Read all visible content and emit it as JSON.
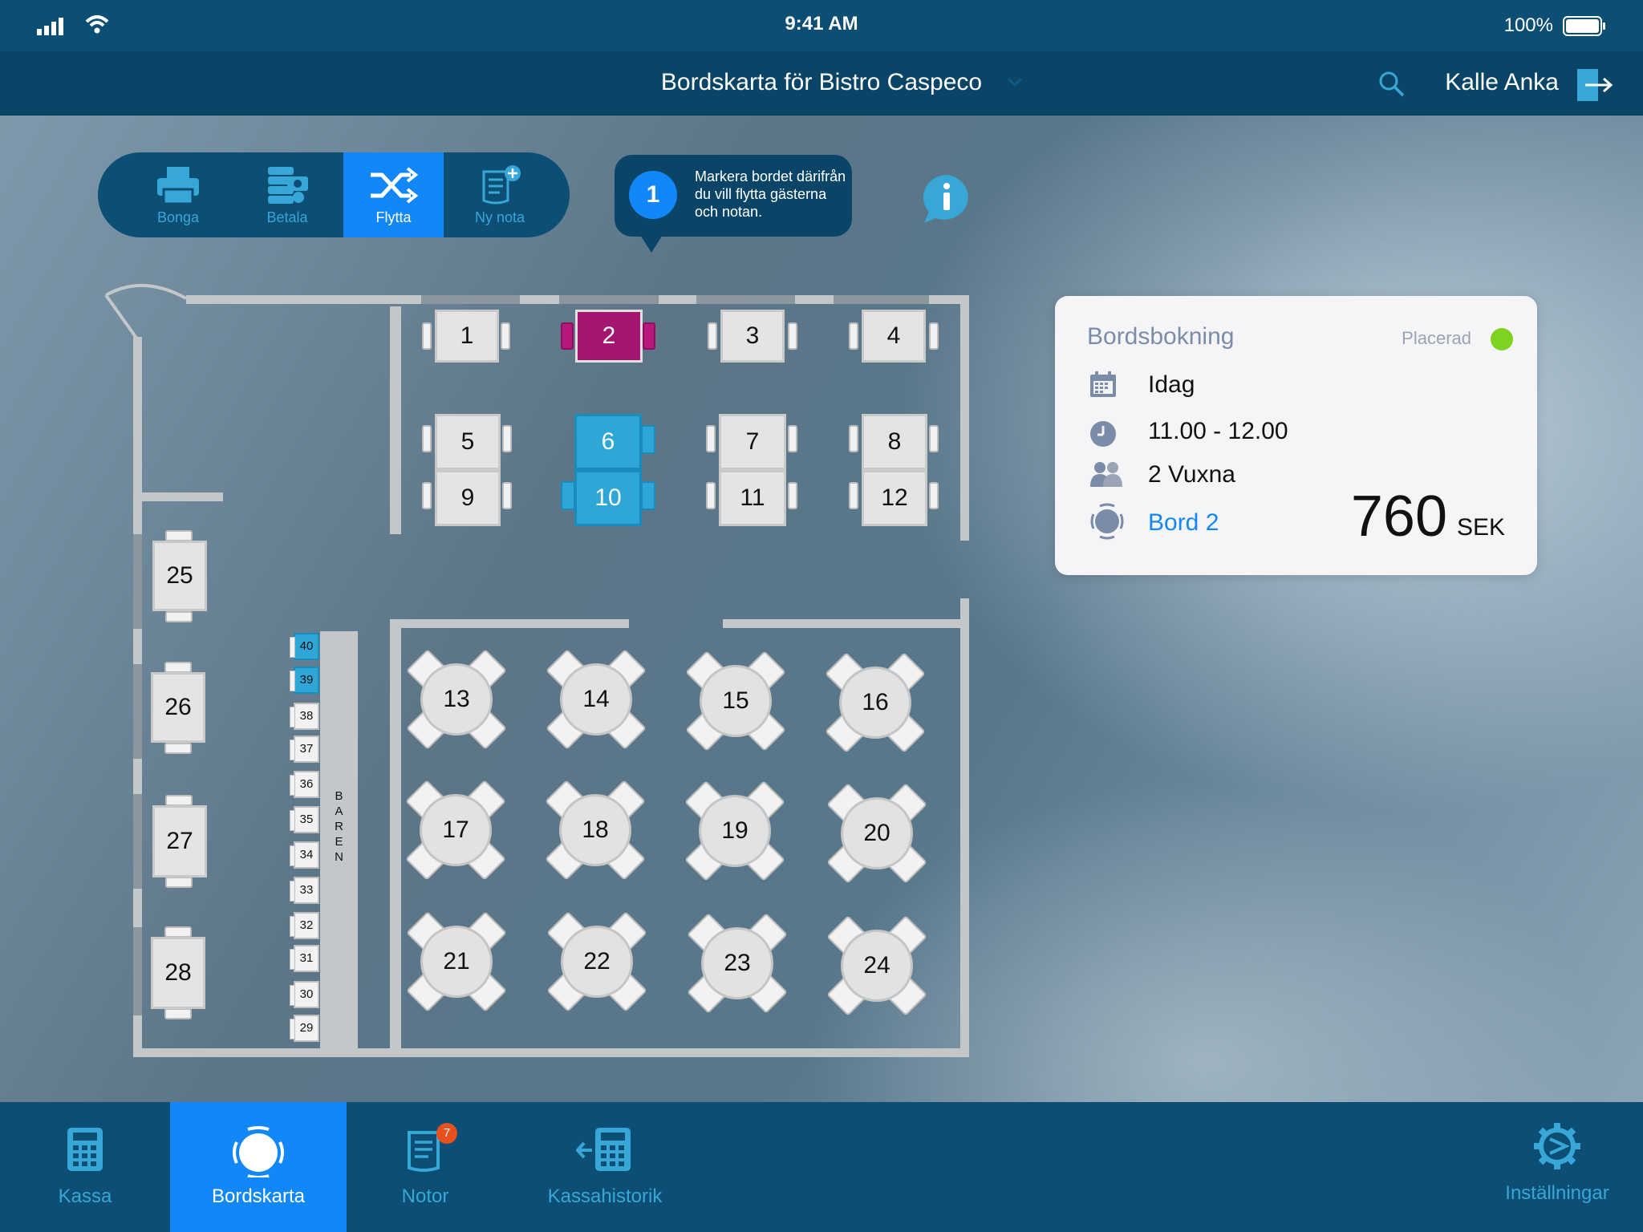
{
  "status_bar": {
    "time": "9:41 AM",
    "battery": "100%"
  },
  "nav": {
    "title": "Bordskarta för Bistro Caspeco",
    "user": "Kalle Anka"
  },
  "toolbar": {
    "bonga": "Bonga",
    "betala": "Betala",
    "flytta": "Flytta",
    "ny_nota": "Ny nota"
  },
  "tooltip": {
    "step": "1",
    "text": "Markera bordet därifrån du vill flytta gästerna och notan."
  },
  "tables": {
    "t1": "1",
    "t2": "2",
    "t3": "3",
    "t4": "4",
    "t5": "5",
    "t6": "6",
    "t7": "7",
    "t8": "8",
    "t9": "9",
    "t10": "10",
    "t11": "11",
    "t12": "12",
    "t13": "13",
    "t14": "14",
    "t15": "15",
    "t16": "16",
    "t17": "17",
    "t18": "18",
    "t19": "19",
    "t20": "20",
    "t21": "21",
    "t22": "22",
    "t23": "23",
    "t24": "24",
    "t25": "25",
    "t26": "26",
    "t27": "27",
    "t28": "28"
  },
  "bar_seats": [
    "40",
    "39",
    "38",
    "37",
    "36",
    "35",
    "34",
    "33",
    "32",
    "31",
    "30",
    "29"
  ],
  "bar_label": "B A R E N",
  "booking": {
    "header": "Bordsbokning",
    "status": "Placerad",
    "date": "Idag",
    "time": "11.00 - 12.00",
    "guests": "2 Vuxna",
    "table": "Bord 2",
    "amount": "760",
    "currency": "SEK"
  },
  "tabs": {
    "kassa": "Kassa",
    "bordskarta": "Bordskarta",
    "notor": "Notor",
    "notor_badge": "7",
    "kassahistorik": "Kassahistorik",
    "installningar": "Inställningar"
  },
  "colors": {
    "active": "#1287f7",
    "selected_table": "#a41471",
    "linked_table": "#2ea6d6",
    "status_dot": "#7ed321"
  }
}
